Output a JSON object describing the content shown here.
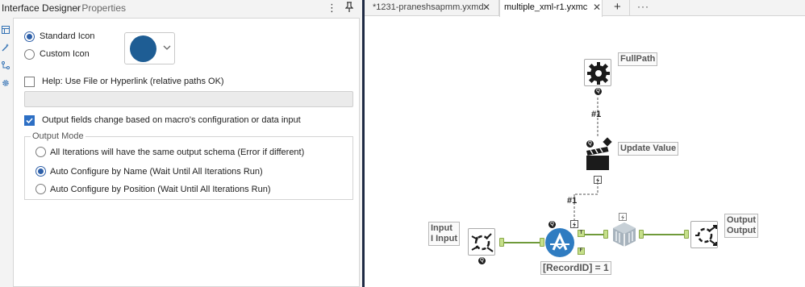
{
  "left_panel": {
    "title": "Interface Designer",
    "subtitle": "- Properties",
    "more_glyph": "⋮",
    "pin_icon": "pin-icon",
    "strip_icons": [
      "layout-icon",
      "wand-icon",
      "tree-icon",
      "gear-icon"
    ]
  },
  "icon_choice": {
    "standard_label": "Standard Icon",
    "custom_label": "Custom Icon",
    "selected": "standard",
    "swatch_color": "#1e5d94"
  },
  "help": {
    "label": "Help: Use File or Hyperlink (relative paths OK)",
    "checked": false,
    "value": ""
  },
  "output_fields": {
    "label": "Output fields change based on macro's configuration or data input",
    "checked": true
  },
  "output_mode": {
    "legend": "Output Mode",
    "options": [
      {
        "label": "All Iterations will have the same output schema (Error if different)",
        "selected": false
      },
      {
        "label": "Auto Configure by Name (Wait Until All Iterations Run)",
        "selected": true
      },
      {
        "label": "Auto Configure by Position (Wait Until All Iterations Run)",
        "selected": false
      }
    ]
  },
  "tabs": [
    {
      "label": "*1231-praneshsapmm.yxmd",
      "close": "✕",
      "active": false
    },
    {
      "label": "multiple_xml-r1.yxmc",
      "close": "✕",
      "active": true
    }
  ],
  "tab_add": "+",
  "tab_more": "···",
  "workflow": {
    "nodes": {
      "fullpath": {
        "label": "FullPath",
        "icon": "gear-icon",
        "badge": "Q"
      },
      "update_value": {
        "label": "Update Value",
        "icon": "clapperboard-icon",
        "badge": "Q"
      },
      "input": {
        "label": "Input\nI Input",
        "icon": "input-arrows-icon",
        "badge": "Q"
      },
      "filter": {
        "label": "[RecordID] = 1",
        "icon": "filter-icon",
        "badge": "Q",
        "true_anchor": "T",
        "false_anchor": "F"
      },
      "condition": {
        "icon": "cube-icon"
      },
      "output": {
        "label": "Output\nOutput",
        "icon": "output-arrows-icon"
      }
    },
    "connection_labels": [
      "#1",
      "#1"
    ],
    "colors": {
      "connector": "#6f9a3a",
      "anchor": "#c6e08a",
      "filter_blue": "#2f7cc1"
    }
  }
}
